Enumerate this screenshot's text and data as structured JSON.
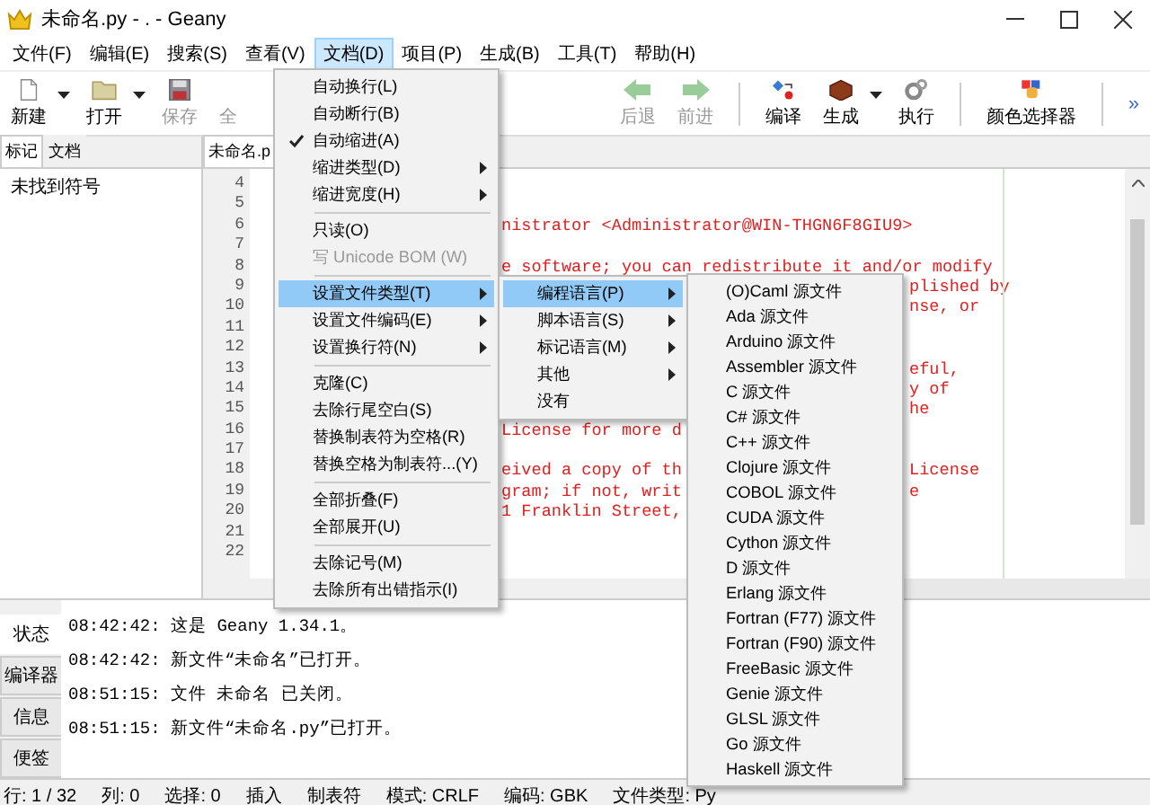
{
  "window": {
    "title": "未命名.py - . - Geany"
  },
  "menu_bar": [
    {
      "label": "文件(F)",
      "selected": false
    },
    {
      "label": "编辑(E)",
      "selected": false
    },
    {
      "label": "搜索(S)",
      "selected": false
    },
    {
      "label": "查看(V)",
      "selected": false
    },
    {
      "label": "文档(D)",
      "selected": true
    },
    {
      "label": "项目(P)",
      "selected": false
    },
    {
      "label": "生成(B)",
      "selected": false
    },
    {
      "label": "工具(T)",
      "selected": false
    },
    {
      "label": "帮助(H)",
      "selected": false
    }
  ],
  "toolbar": {
    "left": [
      {
        "label": "新建",
        "disabled": false,
        "dropdown": true
      },
      {
        "label": "打开",
        "disabled": false,
        "dropdown": true
      },
      {
        "label": "保存",
        "disabled": true,
        "dropdown": false
      },
      {
        "label": "全",
        "disabled": true,
        "dropdown": false
      }
    ],
    "right": [
      {
        "kind": "button",
        "label": "后退",
        "disabled": true,
        "dropdown": false
      },
      {
        "kind": "button",
        "label": "前进",
        "disabled": true,
        "dropdown": false
      },
      {
        "kind": "separator"
      },
      {
        "kind": "button",
        "label": "编译",
        "disabled": false,
        "dropdown": false
      },
      {
        "kind": "button",
        "label": "生成",
        "disabled": false,
        "dropdown": true
      },
      {
        "kind": "button",
        "label": "执行",
        "disabled": false,
        "dropdown": false
      },
      {
        "kind": "separator"
      },
      {
        "kind": "button",
        "label": "颜色选择器",
        "disabled": false,
        "dropdown": false
      },
      {
        "kind": "separator"
      },
      {
        "kind": "overflow",
        "label": "»"
      }
    ]
  },
  "sidebar": {
    "tabs": [
      {
        "label": "标记",
        "selected": true
      },
      {
        "label": "文档",
        "selected": false
      }
    ],
    "message": "未找到符号"
  },
  "editor": {
    "tab": "未命名.p",
    "lines": [
      {
        "number": "4"
      },
      {
        "number": "5"
      },
      {
        "number": "6",
        "left": "nistrator <Administrator@WIN-THGN6F8GIU9>"
      },
      {
        "number": "7"
      },
      {
        "number": "8",
        "left": "e software; you can redistribute it and/or modify"
      },
      {
        "number": "9",
        "right": "plished by"
      },
      {
        "number": "10",
        "right": "nse, or"
      },
      {
        "number": "11"
      },
      {
        "number": "12"
      },
      {
        "number": "13",
        "right": "eful,"
      },
      {
        "number": "14",
        "right": "y of"
      },
      {
        "number": "15",
        "right": "he"
      },
      {
        "number": "16",
        "left": "License for more d"
      },
      {
        "number": "17"
      },
      {
        "number": "18",
        "left": "eived a copy of th",
        "right": "License"
      },
      {
        "number": "19",
        "left": "gram; if not, writ",
        "right": "e"
      },
      {
        "number": "20",
        "left": "1 Franklin Street,"
      },
      {
        "number": "21"
      },
      {
        "number": "22"
      }
    ]
  },
  "document_menu": [
    {
      "kind": "item",
      "label": "自动换行(L)",
      "checked": false,
      "disabled": false,
      "selected": false,
      "has_submenu": false
    },
    {
      "kind": "item",
      "label": "自动断行(B)",
      "checked": false,
      "disabled": false,
      "selected": false,
      "has_submenu": false
    },
    {
      "kind": "item",
      "label": "自动缩进(A)",
      "checked": true,
      "disabled": false,
      "selected": false,
      "has_submenu": false
    },
    {
      "kind": "item",
      "label": "缩进类型(D)",
      "checked": false,
      "disabled": false,
      "selected": false,
      "has_submenu": true
    },
    {
      "kind": "item",
      "label": "缩进宽度(H)",
      "checked": false,
      "disabled": false,
      "selected": false,
      "has_submenu": true
    },
    {
      "kind": "separator"
    },
    {
      "kind": "item",
      "label": "只读(O)",
      "checked": false,
      "disabled": false,
      "selected": false,
      "has_submenu": false
    },
    {
      "kind": "item",
      "label": "写 Unicode BOM (W)",
      "checked": false,
      "disabled": true,
      "selected": false,
      "has_submenu": false
    },
    {
      "kind": "separator"
    },
    {
      "kind": "item",
      "label": "设置文件类型(T)",
      "checked": false,
      "disabled": false,
      "selected": true,
      "has_submenu": true
    },
    {
      "kind": "item",
      "label": "设置文件编码(E)",
      "checked": false,
      "disabled": false,
      "selected": false,
      "has_submenu": true
    },
    {
      "kind": "item",
      "label": "设置换行符(N)",
      "checked": false,
      "disabled": false,
      "selected": false,
      "has_submenu": true
    },
    {
      "kind": "separator"
    },
    {
      "kind": "item",
      "label": "克隆(C)",
      "checked": false,
      "disabled": false,
      "selected": false,
      "has_submenu": false
    },
    {
      "kind": "item",
      "label": "去除行尾空白(S)",
      "checked": false,
      "disabled": false,
      "selected": false,
      "has_submenu": false
    },
    {
      "kind": "item",
      "label": "替换制表符为空格(R)",
      "checked": false,
      "disabled": false,
      "selected": false,
      "has_submenu": false
    },
    {
      "kind": "item",
      "label": "替换空格为制表符...(Y)",
      "checked": false,
      "disabled": false,
      "selected": false,
      "has_submenu": false
    },
    {
      "kind": "separator"
    },
    {
      "kind": "item",
      "label": "全部折叠(F)",
      "checked": false,
      "disabled": false,
      "selected": false,
      "has_submenu": false
    },
    {
      "kind": "item",
      "label": "全部展开(U)",
      "checked": false,
      "disabled": false,
      "selected": false,
      "has_submenu": false
    },
    {
      "kind": "separator"
    },
    {
      "kind": "item",
      "label": "去除记号(M)",
      "checked": false,
      "disabled": false,
      "selected": false,
      "has_submenu": false
    },
    {
      "kind": "item",
      "label": "去除所有出错指示(I)",
      "checked": false,
      "disabled": false,
      "selected": false,
      "has_submenu": false
    }
  ],
  "filetype_menu": [
    {
      "label": "编程语言(P)",
      "selected": true,
      "has_submenu": true
    },
    {
      "label": "脚本语言(S)",
      "selected": false,
      "has_submenu": true
    },
    {
      "label": "标记语言(M)",
      "selected": false,
      "has_submenu": true
    },
    {
      "label": "其他",
      "selected": false,
      "has_submenu": true
    },
    {
      "label": "没有",
      "selected": false,
      "has_submenu": false
    }
  ],
  "language_menu": [
    "(O)Caml 源文件",
    "Ada 源文件",
    "Arduino 源文件",
    "Assembler 源文件",
    "C 源文件",
    "C# 源文件",
    "C++ 源文件",
    "Clojure 源文件",
    "COBOL 源文件",
    "CUDA 源文件",
    "Cython 源文件",
    "D 源文件",
    "Erlang 源文件",
    "Fortran (F77) 源文件",
    "Fortran (F90) 源文件",
    "FreeBasic 源文件",
    "Genie 源文件",
    "GLSL 源文件",
    "Go 源文件",
    "Haskell 源文件"
  ],
  "message_panel": {
    "tabs": [
      {
        "label": "状态",
        "selected": true
      },
      {
        "label": "编译器",
        "selected": false
      },
      {
        "label": "信息",
        "selected": false
      },
      {
        "label": "便签",
        "selected": false
      }
    ],
    "messages": [
      "08:42:42: 这是 Geany 1.34.1。",
      "08:42:42: 新文件“未命名”已打开。",
      "08:51:15: 文件 未命名 已关闭。",
      "08:51:15: 新文件“未命名.py”已打开。"
    ]
  },
  "status_bar": [
    "行: 1 / 32",
    "列: 0",
    "选择: 0",
    "插入",
    "制表符",
    "模式: CRLF",
    "编码: GBK",
    "文件类型: Py"
  ]
}
